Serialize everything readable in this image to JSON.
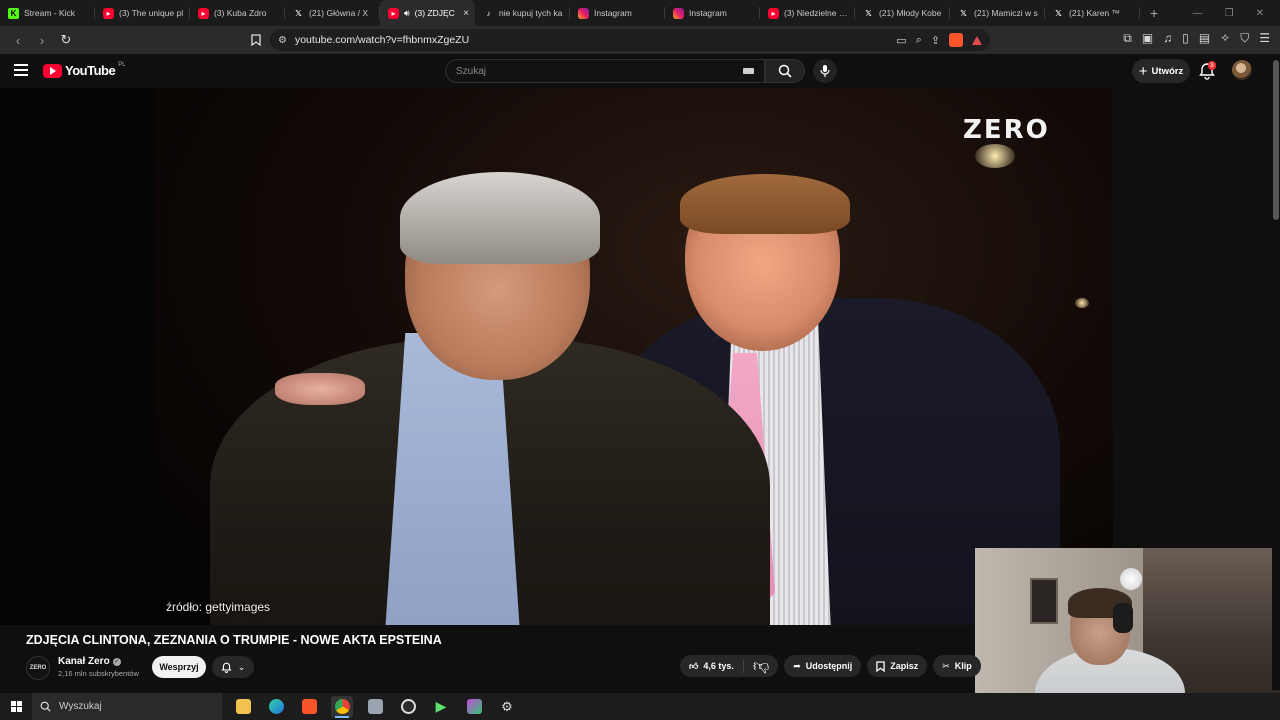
{
  "browser": {
    "tabs": [
      {
        "label": "Stream - Kick",
        "favicon": "kick-icon"
      },
      {
        "label": "(3) The unique pl",
        "favicon": "youtube-icon"
      },
      {
        "label": "(3) Kuba Zdro",
        "favicon": "youtube-icon"
      },
      {
        "label": "(21) Główna / X",
        "favicon": "x-icon"
      },
      {
        "label": "(3) ZDJĘC",
        "favicon": "youtube-icon",
        "active": true,
        "audio": "speaker-icon",
        "close": "×"
      },
      {
        "label": "nie kupuj tych ka",
        "favicon": "tiktok-icon"
      },
      {
        "label": "Instagram",
        "favicon": "instagram-icon"
      },
      {
        "label": "Instagram",
        "favicon": "instagram-icon"
      },
      {
        "label": "(3) Niedzielne cia",
        "favicon": "youtube-icon"
      },
      {
        "label": "(21) Młody Kobe",
        "favicon": "x-icon"
      },
      {
        "label": "(21) Mamiczi w s",
        "favicon": "x-icon"
      },
      {
        "label": "(21) Karen ™",
        "favicon": "x-icon"
      }
    ],
    "new_tab": "+",
    "url": "youtube.com/watch?v=fhbnmxZgeZU"
  },
  "youtube": {
    "logo_text": "YouTube",
    "logo_region": "PL",
    "search_placeholder": "Szukaj",
    "create_label": "Utwórz",
    "notification_count": "3"
  },
  "video": {
    "watermark": "ZERO",
    "source_caption": "źródło: gettyimages",
    "title": "ZDJĘCIA CLINTONA, ZEZNANIA O TRUMPIE - NOWE AKTA EPSTEINA",
    "channel": {
      "avatar_text": "ZERO",
      "name": "Kanał Zero",
      "subscribers": "2,16 mln subskrybentów",
      "support_label": "Wesprzyj"
    },
    "actions": {
      "likes": "4,6 tys.",
      "share_label": "Udostępnij",
      "save_label": "Zapisz",
      "clip_label": "Klip"
    }
  },
  "taskbar": {
    "search_placeholder": "Wyszukaj"
  },
  "colors": {
    "yt_red": "#ff0033",
    "bg": "#0f0f0f",
    "pill": "#272727",
    "tie_pink": "#f2a8c6"
  }
}
